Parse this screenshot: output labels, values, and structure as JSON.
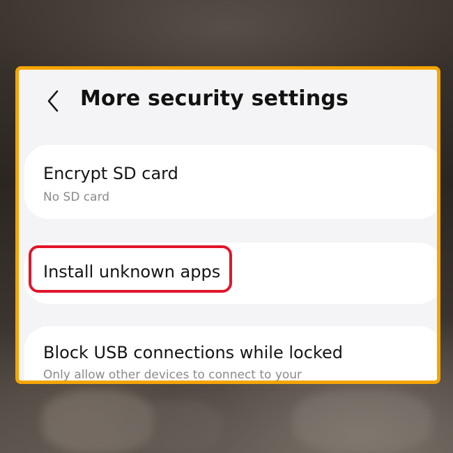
{
  "header": {
    "title": "More security settings",
    "back_icon": "chevron-left-icon"
  },
  "settings": {
    "items": [
      {
        "title": "Encrypt SD card",
        "subtitle": "No SD card"
      },
      {
        "title": "Install unknown apps"
      },
      {
        "title": "Block USB connections while locked",
        "subtitle": "Only allow other devices to connect to your"
      }
    ]
  },
  "colors": {
    "frame_border": "#f5a500",
    "highlight_border": "#e1152b",
    "screen_background": "#f4f4f6",
    "card_background": "#ffffff"
  }
}
